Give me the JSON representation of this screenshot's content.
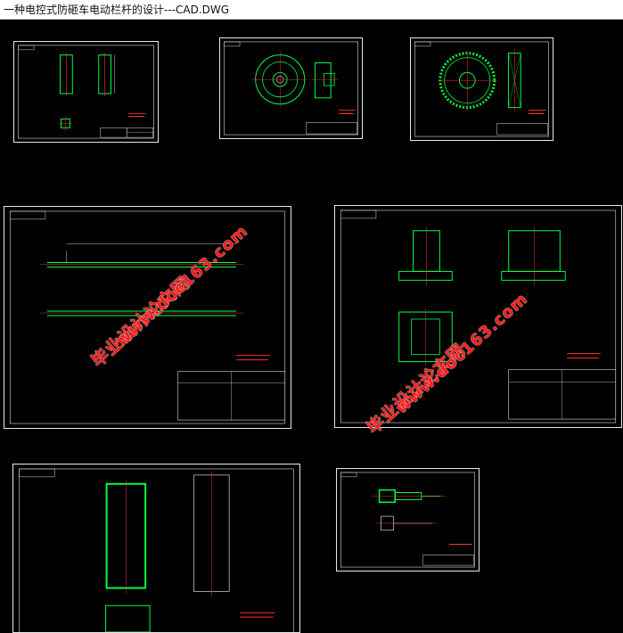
{
  "window": {
    "title": "一种电控式防砸车电动栏杆的设计---CAD.DWG"
  },
  "watermark": {
    "text_cn": "毕业设计论文网",
    "text_url": "www.doc163.com"
  },
  "colors": {
    "background": "#000000",
    "sheet_border": "#e8e8e8",
    "part_lines": "#00ff44",
    "center_lines": "#ff3030",
    "dimensions": "#ffffff",
    "watermark": "#ff1a1a"
  },
  "sheets": [
    {
      "name": "sheet-shaft-views",
      "content": "two rectangular views and small square part"
    },
    {
      "name": "sheet-flange-disk",
      "content": "circular disk with hub and side section"
    },
    {
      "name": "sheet-gear",
      "content": "toothed gear and side section"
    },
    {
      "name": "sheet-long-rod",
      "content": "long barrier rod in two views"
    },
    {
      "name": "sheet-bracket",
      "content": "bracket in three views"
    },
    {
      "name": "sheet-housing",
      "content": "rectangular housing in section"
    },
    {
      "name": "sheet-motor-shaft",
      "content": "stepped shaft assembly"
    }
  ]
}
